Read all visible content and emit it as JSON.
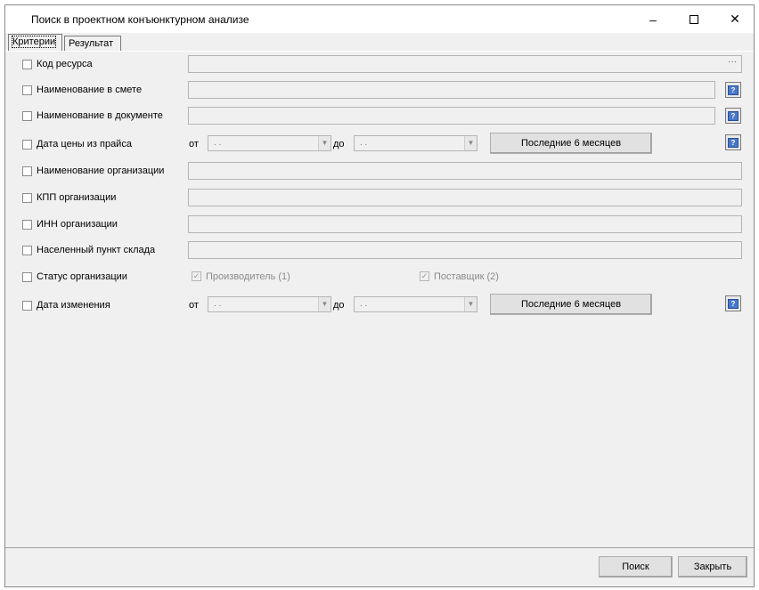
{
  "window": {
    "title": "Поиск в проектном конъюнктурном анализе",
    "controls": {
      "minimize": "–",
      "close": "✕"
    }
  },
  "tabs": [
    {
      "label": "Критерии",
      "active": true
    },
    {
      "label": "Результат",
      "active": false
    }
  ],
  "criteria": {
    "resource_code": {
      "label": "Код ресурса",
      "button": "···"
    },
    "name_in_estimate": {
      "label": "Наименование в смете"
    },
    "name_in_document": {
      "label": "Наименование в документе"
    },
    "price_date": {
      "label": "Дата цены из прайса",
      "from_label": "от",
      "to_label": "до",
      "from_value": " .  .",
      "to_value": " .  .",
      "preset_button": "Последние 6 месяцев"
    },
    "org_name": {
      "label": "Наименование организации"
    },
    "org_kpp": {
      "label": "КПП организации"
    },
    "org_inn": {
      "label": "ИНН организации"
    },
    "warehouse_city": {
      "label": "Населенный пункт склада"
    },
    "org_status": {
      "label": "Статус организации",
      "options": [
        {
          "label": "Производитель (1)",
          "checked": true
        },
        {
          "label": "Поставщик (2)",
          "checked": true
        }
      ]
    },
    "change_date": {
      "label": "Дата изменения",
      "from_label": "от",
      "to_label": "до",
      "from_value": " .  .",
      "to_value": " .  .",
      "preset_button": "Последние 6 месяцев"
    }
  },
  "footer": {
    "search_button": "Поиск",
    "close_button": "Закрыть"
  },
  "icons": {
    "help": "help-icon",
    "combo_arrow": "chevron-down-icon",
    "checkmark": "check-icon"
  }
}
